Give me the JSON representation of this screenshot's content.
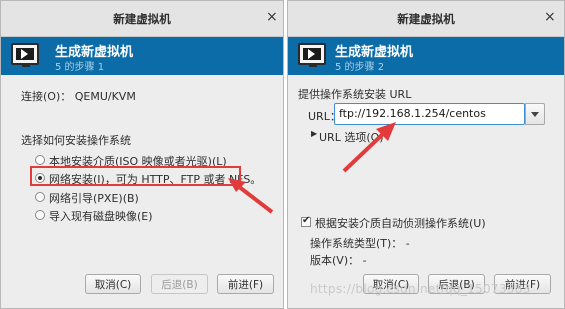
{
  "left_dialog": {
    "window_title": "新建虚拟机",
    "close_glyph": "×",
    "banner": {
      "title": "生成新虚拟机",
      "step": "5 的步骤 1",
      "icon": "vm-monitor-icon"
    },
    "connection": "连接(O)： QEMU/KVM",
    "install_prompt": "选择如何安装操作系统",
    "options": [
      {
        "label": "本地安装介质(ISO 映像或者光驱)(L)",
        "selected": false
      },
      {
        "label": "网络安装(I)，可为 HTTP、FTP 或者 NFS。",
        "selected": true
      },
      {
        "label": "网络引导(PXE)(B)",
        "selected": false
      },
      {
        "label": "导入现有磁盘映像(E)",
        "selected": false
      }
    ],
    "buttons": {
      "cancel": "取消(C)",
      "back": "后退(B)",
      "forward": "前进(F)"
    }
  },
  "right_dialog": {
    "window_title": "新建虚拟机",
    "close_glyph": "×",
    "banner": {
      "title": "生成新虚拟机",
      "step": "5 的步骤 2",
      "icon": "vm-monitor-icon"
    },
    "url_prompt": "提供操作系统安装 URL",
    "url_label": "URL：",
    "url_value": "ftp://192.168.1.254/centos",
    "url_options": "URL 选项(O)",
    "auto_detect": {
      "label": "根据安装介质自动侦测操作系统(U)",
      "checked": true
    },
    "os_type": "操作系统类型(T)：  -",
    "version": "版本(V)：  -",
    "buttons": {
      "cancel": "取消(C)",
      "back": "后退(B)",
      "forward": "前进(F)"
    }
  },
  "watermark": "https://blog.csdn.net/qq_15073383",
  "colors": {
    "banner": "#0b6ca8",
    "annotation": "#e23b3b",
    "input_focus": "#3e8fd6"
  }
}
